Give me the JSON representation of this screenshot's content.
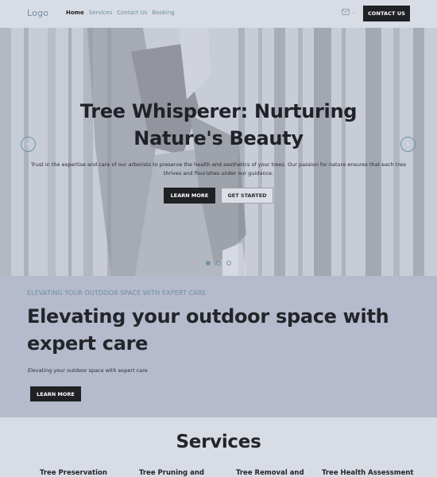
{
  "header": {
    "logo": "Logo",
    "nav": [
      {
        "label": "Home",
        "active": true
      },
      {
        "label": "Services",
        "active": false
      },
      {
        "label": "Contact Us",
        "active": false
      },
      {
        "label": "Booking",
        "active": false
      }
    ],
    "language_icon": "flag-icon",
    "contact_button": "CONTACT US"
  },
  "hero": {
    "title": "Tree Whisperer: Nurturing Nature's Beauty",
    "description": "Trust in the expertise and care of our arborists to preserve the health and aesthetics of your trees. Our passion for nature ensures that each tree thrives and flourishes under our guidance.",
    "primary_button": "LEARN MORE",
    "secondary_button": "GET STARTED",
    "prev_icon": "‹",
    "next_icon": "›",
    "slides_total": 3,
    "active_slide": 1
  },
  "about": {
    "eyebrow": "ELEVATING YOUR OUTDOOR SPACE WITH EXPERT CARE",
    "title": "Elevating your outdoor space with expert care",
    "text": "Elevating your outdoor space with expert care",
    "button": "LEARN MORE"
  },
  "services": {
    "title": "Services",
    "items": [
      "Tree Preservation",
      "Tree Pruning and",
      "Tree Removal and",
      "Tree Health Assessment"
    ]
  },
  "colors": {
    "accent": "#6e8ea0",
    "dark": "#202124",
    "header_bg": "#d8dce4",
    "about_bg": "#b5bbcc"
  }
}
